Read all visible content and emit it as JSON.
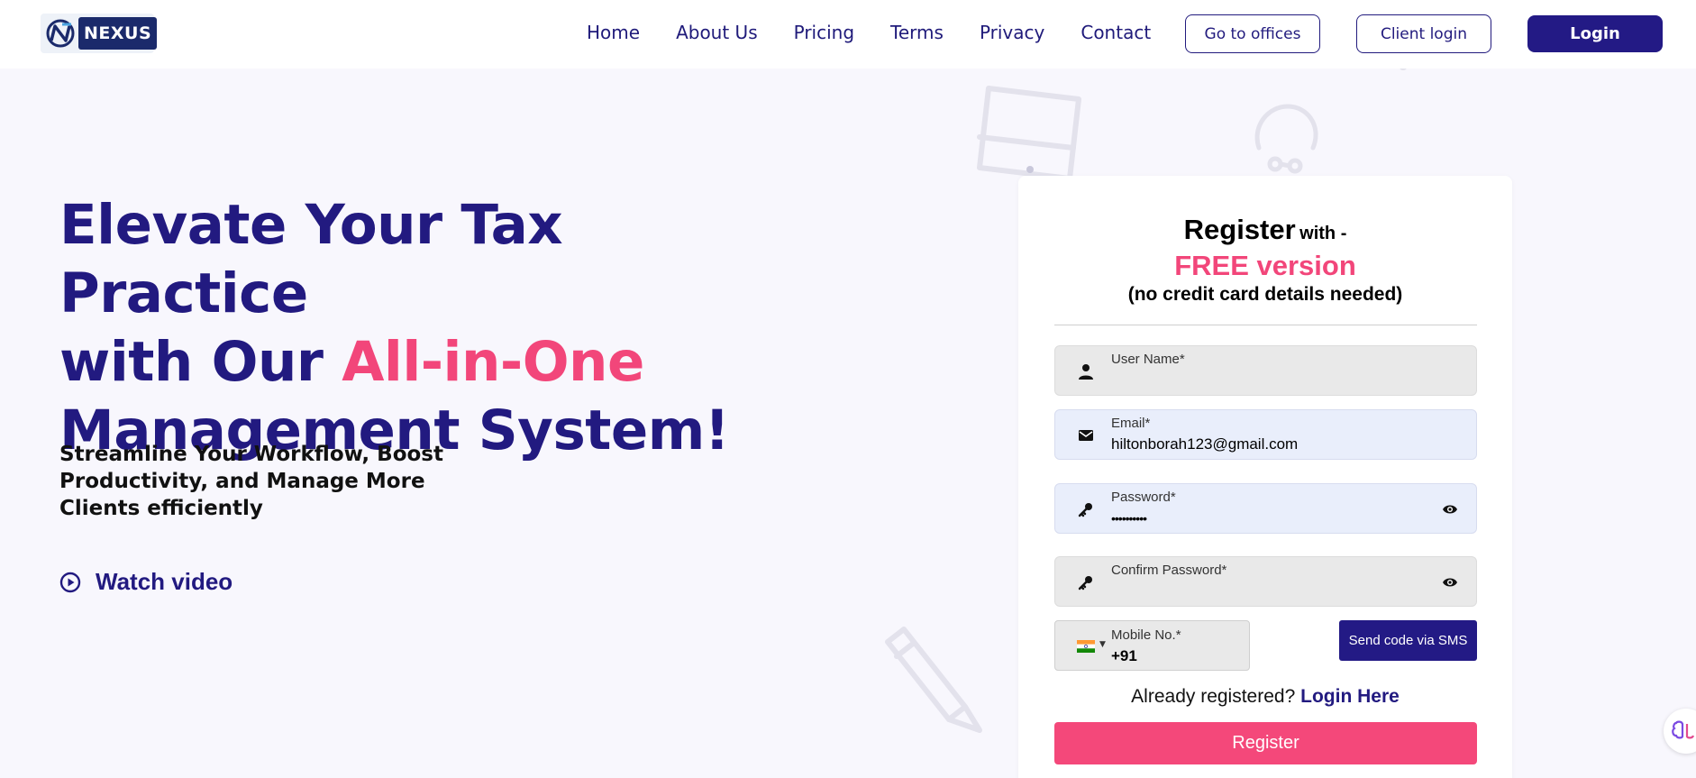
{
  "brand": {
    "name": "NEXUS"
  },
  "nav": {
    "items": [
      "Home",
      "About Us",
      "Pricing",
      "Terms",
      "Privacy",
      "Contact"
    ],
    "offices_label": "Go to offices",
    "client_login_label": "Client login",
    "login_label": "Login"
  },
  "hero": {
    "title_line1": "Elevate Your Tax Practice",
    "title_line2_prefix": "with Our ",
    "title_line2_accent": "All-in-One",
    "title_line3": "Management System!",
    "subtitle": "Streamline Your Workflow, Boost Productivity, and Manage More Clients efficiently",
    "watch_label": "Watch video"
  },
  "register": {
    "heading": "Register",
    "heading_suffix": "with -",
    "free_label": "FREE version",
    "no_card_note": "(no credit card details needed)",
    "fields": {
      "username": {
        "label": "User Name*",
        "value": ""
      },
      "email": {
        "label": "Email*",
        "value": "hiltonborah123@gmail.com"
      },
      "password": {
        "label": "Password*",
        "value": "••••••••••"
      },
      "confirm_password": {
        "label": "Confirm Password*",
        "value": ""
      },
      "mobile": {
        "label": "Mobile No.*",
        "value": "+91"
      }
    },
    "sms_label": "Send code via SMS",
    "already_text": "Already registered?",
    "login_here": "Login Here",
    "submit_label": "Register"
  },
  "colors": {
    "primary": "#231a85",
    "accent": "#f2467a",
    "background": "#f8f7fd"
  }
}
